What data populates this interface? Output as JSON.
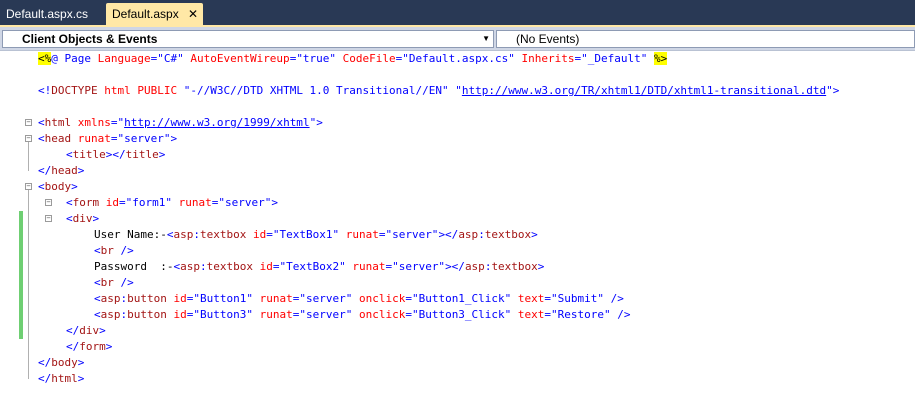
{
  "tabs": [
    {
      "label": "Default.aspx.cs",
      "active": false
    },
    {
      "label": "Default.aspx",
      "active": true
    }
  ],
  "navbar": {
    "left_combo": "Client Objects & Events",
    "right_combo": "(No Events)"
  },
  "code": {
    "l1": {
      "t1": "<%",
      "t2": "@ Page ",
      "t3": "Language",
      "t4": "=",
      "t5": "\"C#\"",
      "t6": " AutoEventWireup",
      "t7": "=",
      "t8": "\"true\"",
      "t9": " CodeFile",
      "t10": "=",
      "t11": "\"Default.aspx.cs\"",
      "t12": " Inherits",
      "t13": "=",
      "t14": "\"_Default\"",
      "t15": " ",
      "t16": "%>"
    },
    "l3": {
      "t1": "<!",
      "t2": "DOCTYPE",
      "t3": " html ",
      "t4": "PUBLIC",
      "t5": " \"-//W3C//DTD XHTML 1.0 Transitional//EN\" ",
      "t6": "\"",
      "t7": "http://www.w3.org/TR/xhtml1/DTD/xhtml1-transitional.dtd",
      "t8": "\"",
      "t9": ">"
    },
    "l5": {
      "t1": "<",
      "t2": "html",
      "t3": " xmlns",
      "t4": "=",
      "t5": "\"",
      "t6": "http://www.w3.org/1999/xhtml",
      "t7": "\"",
      "t8": ">"
    },
    "l6": {
      "t1": "<",
      "t2": "head",
      "t3": " runat",
      "t4": "=",
      "t5": "\"server\"",
      "t6": ">"
    },
    "l7": {
      "t1": "<",
      "t2": "title",
      "t3": "></",
      "t4": "title",
      "t5": ">"
    },
    "l8": {
      "t1": "</",
      "t2": "head",
      "t3": ">"
    },
    "l9": {
      "t1": "<",
      "t2": "body",
      "t3": ">"
    },
    "l10": {
      "t1": "<",
      "t2": "form",
      "t3": " id",
      "t4": "=",
      "t5": "\"form1\"",
      "t6": " runat",
      "t7": "=",
      "t8": "\"server\"",
      "t9": ">"
    },
    "l11": {
      "t1": "<",
      "t2": "div",
      "t3": ">"
    },
    "l12": {
      "t1": "User Name:-",
      "t2": "<",
      "t3": "asp",
      "t4": ":",
      "t5": "textbox",
      "t6": " id",
      "t7": "=",
      "t8": "\"TextBox1\"",
      "t9": " runat",
      "t10": "=",
      "t11": "\"server\"",
      "t12": "></",
      "t13": "asp",
      "t14": ":",
      "t15": "textbox",
      "t16": ">"
    },
    "l13": {
      "t1": "<",
      "t2": "br",
      "t3": " />"
    },
    "l14": {
      "t1": "Password  :-",
      "t2": "<",
      "t3": "asp",
      "t4": ":",
      "t5": "textbox",
      "t6": " id",
      "t7": "=",
      "t8": "\"TextBox2\"",
      "t9": " runat",
      "t10": "=",
      "t11": "\"server\"",
      "t12": "></",
      "t13": "asp",
      "t14": ":",
      "t15": "textbox",
      "t16": ">"
    },
    "l15": {
      "t1": "<",
      "t2": "br",
      "t3": " />"
    },
    "l16": {
      "t1": "<",
      "t2": "asp",
      "t3": ":",
      "t4": "button",
      "t5": " id",
      "t6": "=",
      "t7": "\"Button1\"",
      "t8": " runat",
      "t9": "=",
      "t10": "\"server\"",
      "t11": " onclick",
      "t12": "=",
      "t13": "\"Button1_Click\"",
      "t14": " text",
      "t15": "=",
      "t16": "\"Submit\"",
      "t17": " />"
    },
    "l17": {
      "t1": "<",
      "t2": "asp",
      "t3": ":",
      "t4": "button",
      "t5": " id",
      "t6": "=",
      "t7": "\"Button3\"",
      "t8": " runat",
      "t9": "=",
      "t10": "\"server\"",
      "t11": " onclick",
      "t12": "=",
      "t13": "\"Button3_Click\"",
      "t14": " text",
      "t15": "=",
      "t16": "\"Restore\"",
      "t17": " />"
    },
    "l18": {
      "t1": "</",
      "t2": "div",
      "t3": ">"
    },
    "l19": {
      "t1": "</",
      "t2": "form",
      "t3": ">"
    },
    "l20": {
      "t1": "</",
      "t2": "body",
      "t3": ">"
    },
    "l21": {
      "t1": "</",
      "t2": "html",
      "t3": ">"
    }
  },
  "icons": {
    "close": "close-icon",
    "dropdown": "chevron-down-icon",
    "collapse": "minus-icon"
  },
  "colors": {
    "tab_bg": "#293955",
    "active_tab": "#ffe8a6",
    "change_bar": "#6fcf73"
  }
}
